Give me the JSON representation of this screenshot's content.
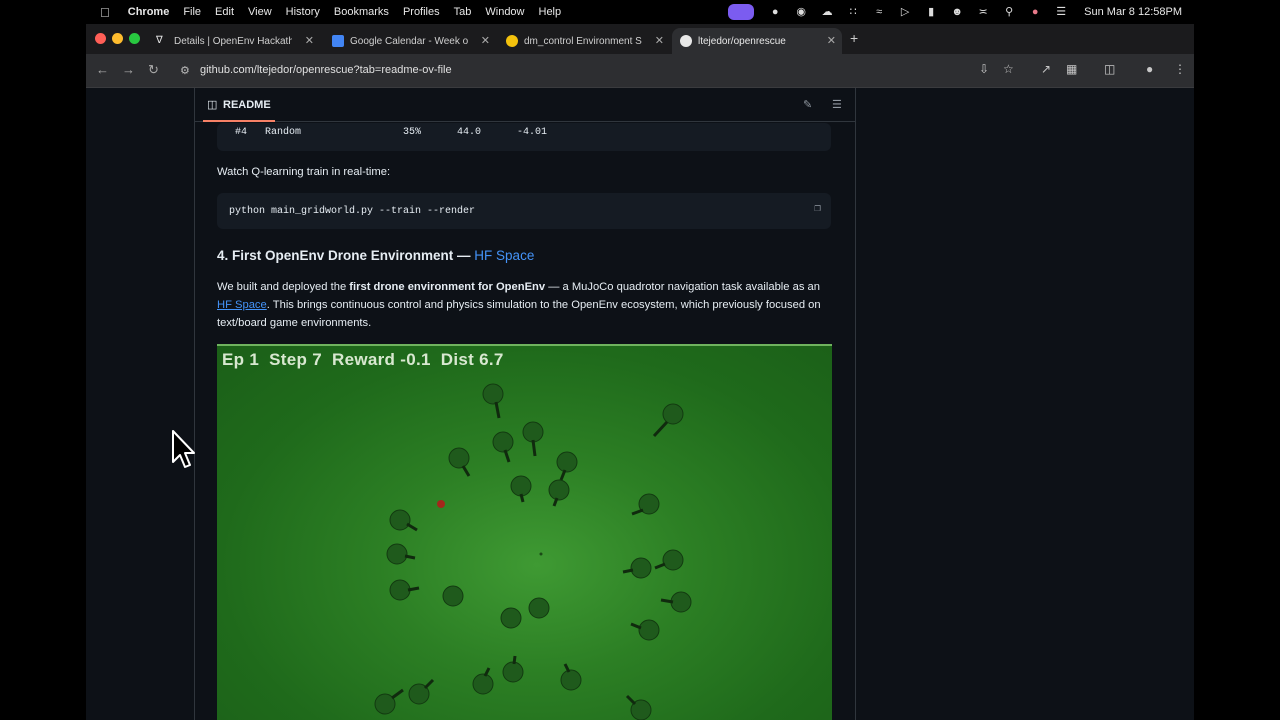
{
  "menubar": {
    "app": "Chrome",
    "menus": [
      "File",
      "Edit",
      "View",
      "History",
      "Bookmarks",
      "Profiles",
      "Tab",
      "Window",
      "Help"
    ],
    "datetime": "Sun Mar 8  12:58PM"
  },
  "tabs": [
    {
      "label": "Details | OpenEnv Hackathon",
      "icon_color": "#e8e8e8"
    },
    {
      "label": "Google Calendar - Week of M",
      "icon_color": "#4285f4"
    },
    {
      "label": "dm_control Environment Ser",
      "icon_color": "#f4c20d"
    },
    {
      "label": "ltejedor/openrescue",
      "icon_color": "#e8e8e8"
    }
  ],
  "address": {
    "url": "github.com/ltejedor/openrescue?tab=readme-ov-file"
  },
  "readme": {
    "title": "README",
    "table_row": {
      "rank": "#4",
      "name": "Random",
      "pct": "35%",
      "avg": "44.0",
      "reward": "-4.01"
    },
    "watch_text": "Watch Q-learning train in real-time:",
    "code": "python main_gridworld.py --train --render",
    "heading": "4. First OpenEnv Drone Environment — ",
    "heading_link": "HF Space",
    "para_1": "We built and deployed the ",
    "para_bold": "first drone environment for OpenEnv",
    "para_2": " — a MuJoCo quadrotor navigation task available as an ",
    "para_link": "HF Space",
    "para_3": ". This brings continuous control and physics simulation to the OpenEnv ecosystem, which previously focused on text/board game environments."
  },
  "simulation": {
    "hud": "Ep 1  Step 7  Reward -0.1  Dist 6.7"
  }
}
